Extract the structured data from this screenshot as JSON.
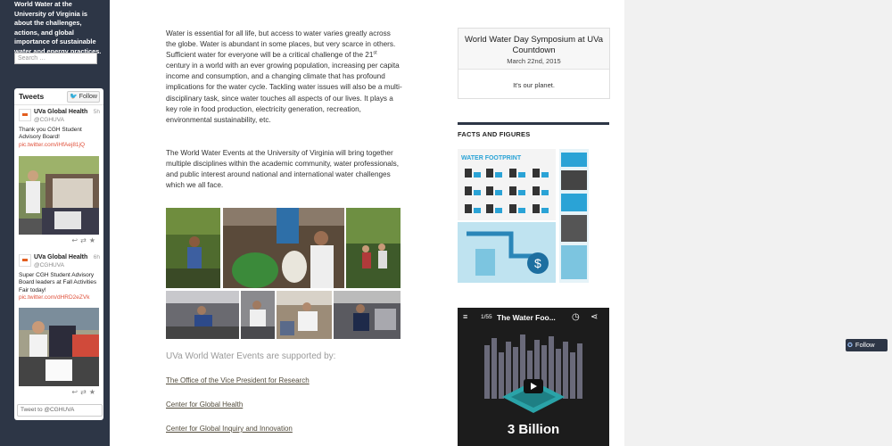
{
  "sidebar": {
    "site_description": "World Water at the University of Virginia is about the challenges, actions, and global importance of sustainable water and energy practices.",
    "search_placeholder": "Search …"
  },
  "twitter_widget": {
    "title": "Tweets",
    "follow_label": "Follow",
    "compose_placeholder": "Tweet to @CGHUVA",
    "tweets": [
      {
        "name": "UVa Global Health",
        "handle": "@CGHUVA",
        "time": "5h",
        "text": "Thank you CGH Student Advisory Board!",
        "link": "pic.twitter.com/iHfAej81jQ"
      },
      {
        "name": "UVa Global Health",
        "handle": "@CGHUVA",
        "time": "6h",
        "text": "Super CGH Student Advisory Board leaders at Fall Activities Fair today!",
        "link": "pic.twitter.com/dHRD2eZVk"
      }
    ]
  },
  "main": {
    "paragraph1_part1": "Water is essential for all life, but access to water varies greatly across the globe. Water is abundant in some places, but very scarce in others. Sufficient water for everyone will be a critical challenge of the 21",
    "paragraph1_sup": "st",
    "paragraph1_part2": " century in a world with an ever growing population, increasing per capita income and consumption, and a changing climate that has profound implications for the water cycle. Tackling water issues will also be a multi-disciplinary task, since water touches all aspects of our lives. It plays a key role in food production, electricity generation, recreation, environmental sustainability, etc.",
    "paragraph2": "The World Water Events at the University of Virginia will bring together multiple disciplines within the academic community, water professionals, and public interest around national and international water challenges which we all face.",
    "supported_by": "UVa World Water Events are supported by:",
    "links": [
      "The Office of the Vice President for Research",
      "Center for Global Health",
      "Center for Global Inquiry and Innovation"
    ]
  },
  "right_sidebar": {
    "countdown_title": "World Water Day Symposium at UVa Countdown",
    "countdown_date": "March 22nd, 2015",
    "countdown_message": "It's our planet.",
    "facts_title": "FACTS AND FIGURES",
    "infographic_heading": "WATER FOOTPRINT",
    "video_count": "1/55",
    "video_title": "The Water Foo...",
    "video_stat": "3 Billion"
  },
  "follow_button": {
    "label": "Follow"
  },
  "colors": {
    "sidebar_bg": "#2d3646",
    "link_color": "#524b3b",
    "accent_red": "#e0503a"
  }
}
